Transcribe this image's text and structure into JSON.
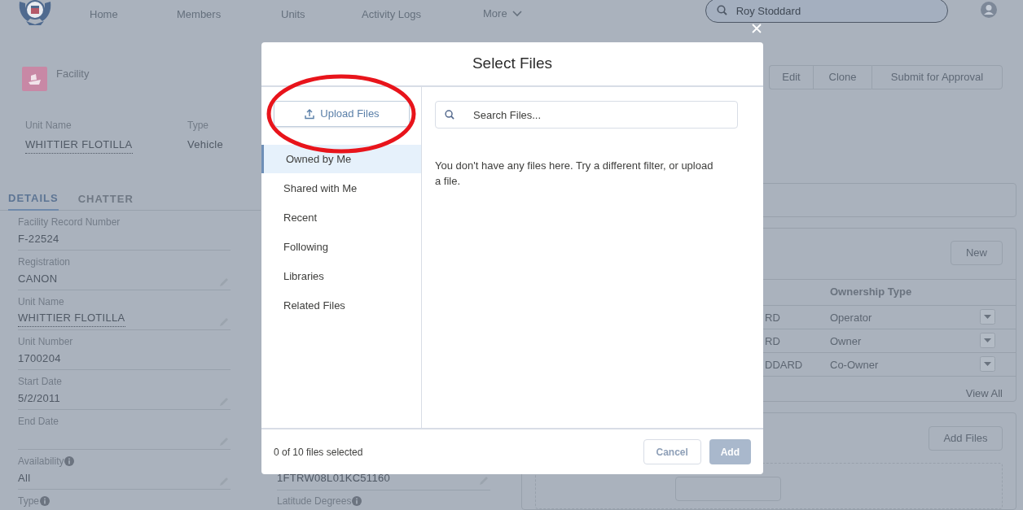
{
  "nav": {
    "items": [
      "Home",
      "Members",
      "Units",
      "Activity Logs"
    ],
    "more": "More",
    "search_value": "Roy Stoddard"
  },
  "record": {
    "object_label": "Facility",
    "highlights": [
      {
        "label": "Unit Name",
        "value": "WHITTIER FLOTILLA",
        "link": true
      },
      {
        "label": "Type",
        "value": "Vehicle",
        "link": false
      }
    ],
    "actions": [
      "Edit",
      "Clone",
      "Submit for Approval"
    ]
  },
  "tabs": [
    {
      "label": "DETAILS",
      "selected": true
    },
    {
      "label": "CHATTER",
      "selected": false
    }
  ],
  "fields": [
    {
      "label": "Facility Record Number",
      "value": "F-22524",
      "editable": false,
      "info": false,
      "link": false
    },
    {
      "label": "Registration",
      "value": "CANON",
      "editable": true,
      "info": false,
      "link": false
    },
    {
      "label": "Unit Name",
      "value": "WHITTIER FLOTILLA",
      "editable": true,
      "info": false,
      "link": true
    },
    {
      "label": "Unit Number",
      "value": "1700204",
      "editable": false,
      "info": false,
      "link": false
    },
    {
      "label": "Start Date",
      "value": "5/2/2011",
      "editable": true,
      "info": false,
      "link": false
    },
    {
      "label": "End Date",
      "editable": true,
      "info": false
    },
    {
      "label": "Availability",
      "value": "All",
      "editable": true,
      "info": true,
      "link": false
    },
    {
      "label": "Type",
      "editable": false,
      "info": true
    }
  ],
  "fields_col2": [
    {
      "value": "1FTRW08L01KC51160",
      "editable": true
    },
    {
      "label": "Latitude Degrees",
      "info": true
    }
  ],
  "ownership": {
    "new_button": "New",
    "column": "Ownership Type",
    "rows": [
      {
        "column_1": "RD",
        "ownership_type": "Operator"
      },
      {
        "column_1": "RD",
        "ownership_type": "Owner"
      },
      {
        "column_1": "DDARD",
        "ownership_type": "Co-Owner"
      }
    ],
    "view_all": "View All"
  },
  "files": {
    "button": "Add Files"
  },
  "modal": {
    "title": "Select Files",
    "upload_button": "Upload Files",
    "filters": [
      {
        "label": "Owned by Me",
        "selected": true
      },
      {
        "label": "Shared with Me",
        "selected": false
      },
      {
        "label": "Recent",
        "selected": false
      },
      {
        "label": "Following",
        "selected": false
      },
      {
        "label": "Libraries",
        "selected": false
      },
      {
        "label": "Related Files",
        "selected": false
      }
    ],
    "search_placeholder": "Search Files...",
    "empty_message": "You don't have any files here. Try a different filter, or upload a file.",
    "selection_count": "0 of 10 files selected",
    "buttons": [
      {
        "label": "Cancel",
        "disabled": false
      },
      {
        "label": "Add",
        "disabled": true
      }
    ]
  }
}
